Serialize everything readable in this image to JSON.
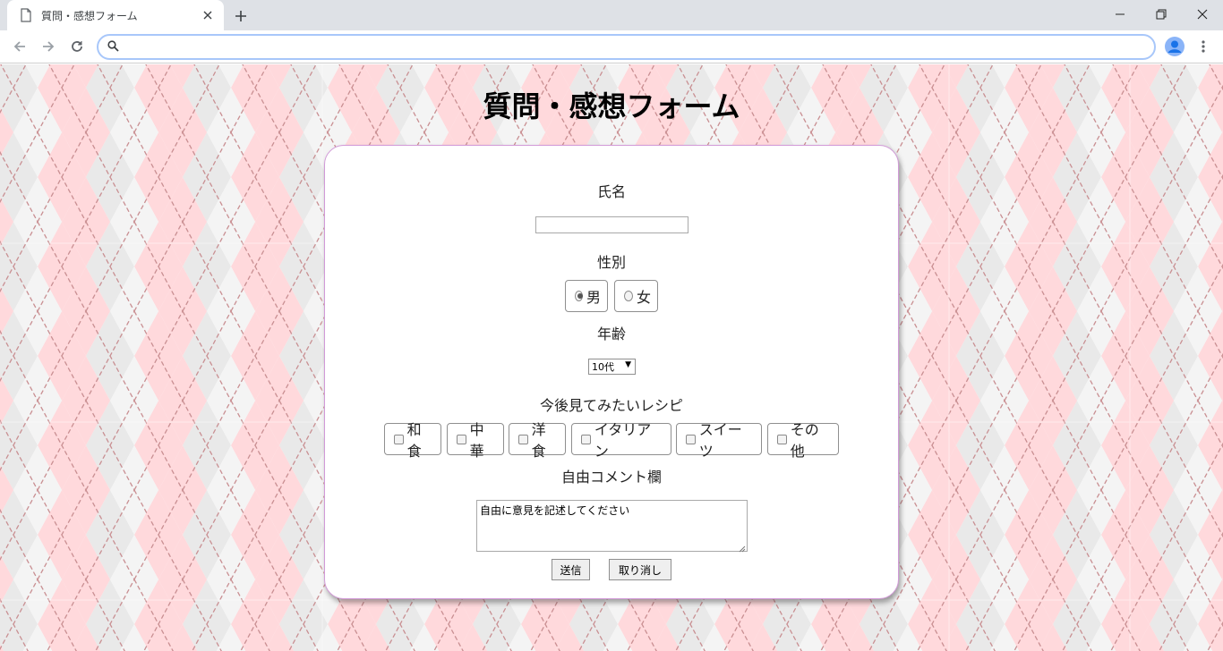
{
  "browser": {
    "tab_title": "質問・感想フォーム",
    "address_value": ""
  },
  "page": {
    "title": "質問・感想フォーム",
    "name_label": "氏名",
    "name_value": "",
    "gender_label": "性別",
    "gender_options": [
      {
        "label": "男",
        "checked": true
      },
      {
        "label": "女",
        "checked": false
      }
    ],
    "age_label": "年齢",
    "age_selected": "10代",
    "recipe_label": "今後見てみたいレシピ",
    "recipe_options": [
      "和食",
      "中華",
      "洋食",
      "イタリアン",
      "スイーツ",
      "その他"
    ],
    "comment_label": "自由コメント欄",
    "comment_placeholder": "自由に意見を記述してください",
    "submit_label": "送信",
    "reset_label": "取り消し"
  }
}
